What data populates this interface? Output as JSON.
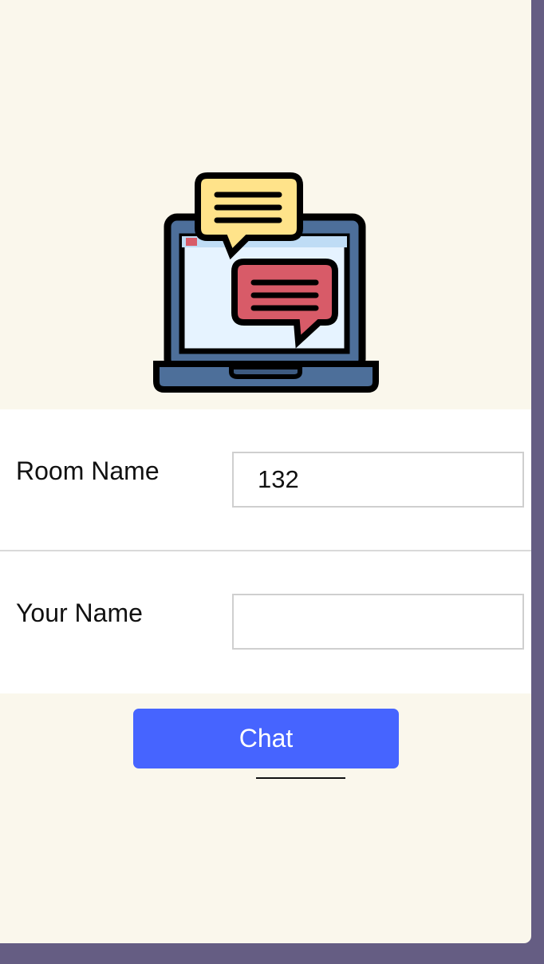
{
  "hero": {
    "illustration": "laptop-chat-icon"
  },
  "form": {
    "room": {
      "label": "Room Name",
      "value": "132",
      "placeholder": ""
    },
    "name": {
      "label": "Your Name",
      "value": "",
      "placeholder": ""
    }
  },
  "actions": {
    "chat_label": "Chat"
  },
  "colors": {
    "background": "#faf7ec",
    "frame": "#655d83",
    "form_background": "#ffffff",
    "button": "#4664ff",
    "bubble_yellow": "#ffe38a",
    "bubble_red": "#d85b68",
    "laptop": "#4d6f9a",
    "screen": "#e6f3ff"
  }
}
